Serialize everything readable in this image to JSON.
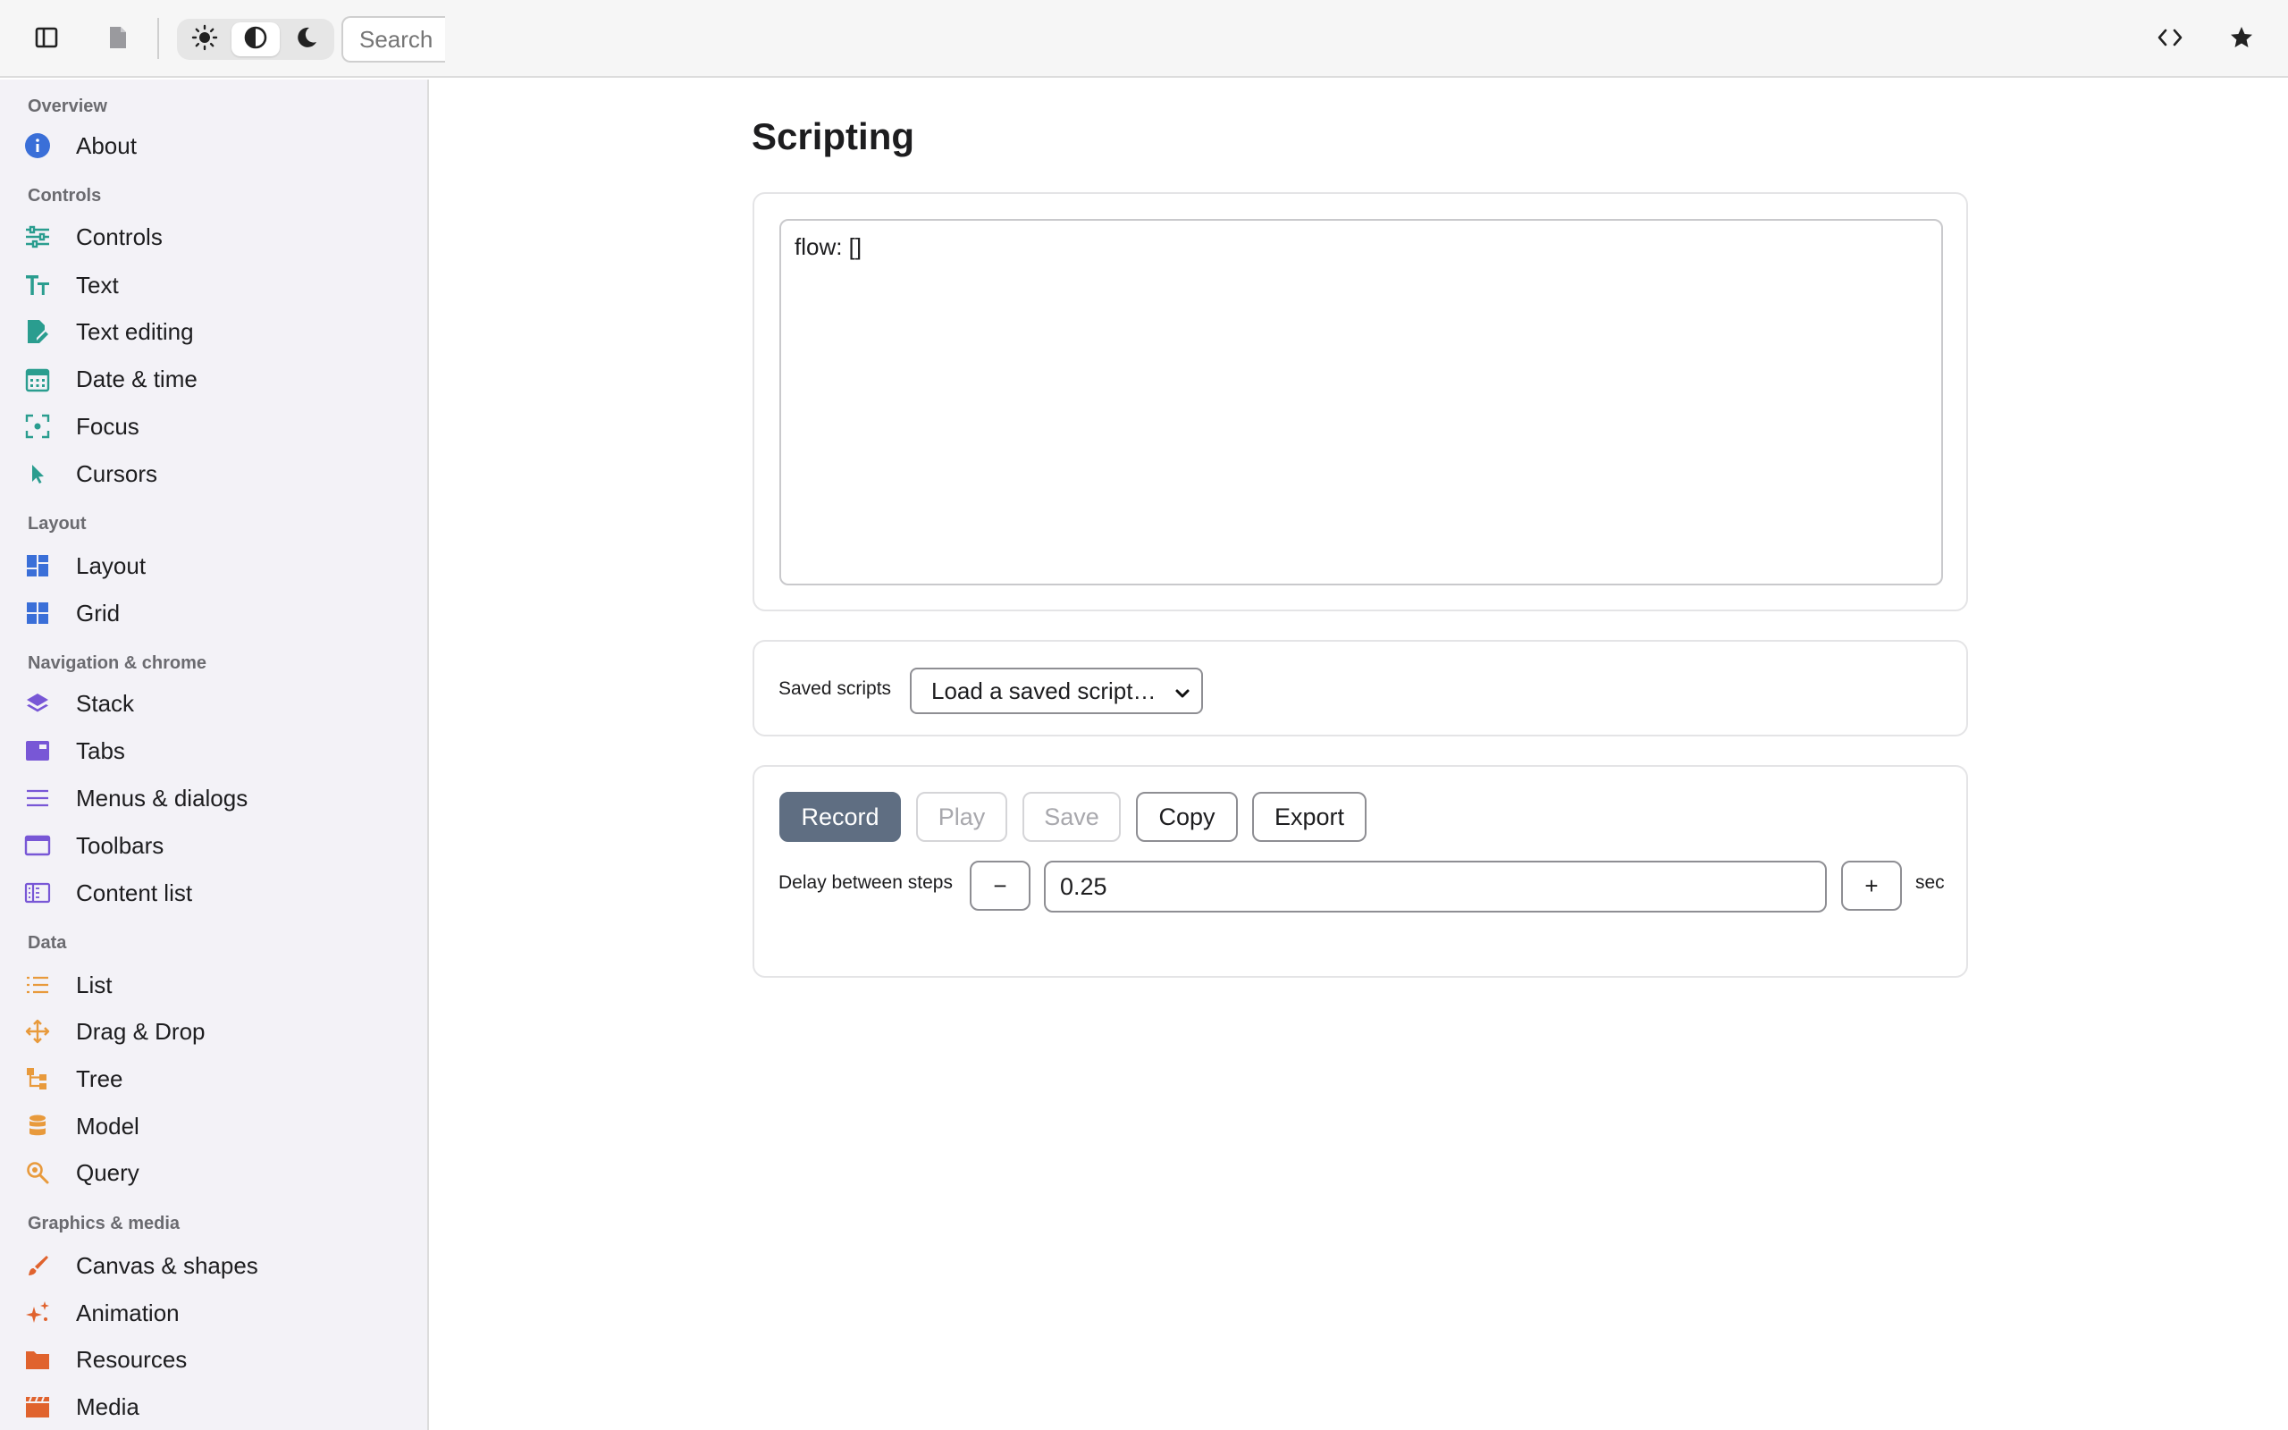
{
  "toolbar": {
    "search_placeholder": "Search",
    "icons": [
      "sidebar-toggle-icon",
      "file-icon",
      "sun-icon",
      "contrast-icon",
      "moon-icon",
      "code-icon",
      "star-icon"
    ]
  },
  "sidebar": {
    "sections": [
      {
        "title": "Overview",
        "items": [
          {
            "label": "About",
            "icon": "info-icon"
          }
        ]
      },
      {
        "title": "Controls",
        "items": [
          {
            "label": "Controls",
            "icon": "sliders-icon"
          },
          {
            "label": "Text",
            "icon": "text-size-icon"
          },
          {
            "label": "Text editing",
            "icon": "edit-document-icon"
          },
          {
            "label": "Date & time",
            "icon": "calendar-icon"
          },
          {
            "label": "Focus",
            "icon": "focus-icon"
          },
          {
            "label": "Cursors",
            "icon": "cursor-icon"
          }
        ]
      },
      {
        "title": "Layout",
        "items": [
          {
            "label": "Layout",
            "icon": "layout-icon"
          },
          {
            "label": "Grid",
            "icon": "grid-icon"
          }
        ]
      },
      {
        "title": "Navigation & chrome",
        "items": [
          {
            "label": "Stack",
            "icon": "stack-icon"
          },
          {
            "label": "Tabs",
            "icon": "tabs-icon"
          },
          {
            "label": "Menus & dialogs",
            "icon": "menu-icon"
          },
          {
            "label": "Toolbars",
            "icon": "toolbar-icon"
          },
          {
            "label": "Content list",
            "icon": "content-list-icon"
          }
        ]
      },
      {
        "title": "Data",
        "items": [
          {
            "label": "List",
            "icon": "list-icon"
          },
          {
            "label": "Drag & Drop",
            "icon": "move-icon"
          },
          {
            "label": "Tree",
            "icon": "tree-icon"
          },
          {
            "label": "Model",
            "icon": "database-icon"
          },
          {
            "label": "Query",
            "icon": "query-icon"
          }
        ]
      },
      {
        "title": "Graphics & media",
        "items": [
          {
            "label": "Canvas & shapes",
            "icon": "brush-icon"
          },
          {
            "label": "Animation",
            "icon": "sparkles-icon"
          },
          {
            "label": "Resources",
            "icon": "folder-icon"
          },
          {
            "label": "Media",
            "icon": "clapperboard-icon"
          }
        ]
      }
    ]
  },
  "main": {
    "title": "Scripting",
    "editor_value": "flow: []",
    "saved_scripts_label": "Saved scripts",
    "saved_scripts_selected": "Load a saved script…",
    "buttons": {
      "record": "Record",
      "play": "Play",
      "save": "Save",
      "copy": "Copy",
      "export": "Export"
    },
    "delay_label": "Delay between steps",
    "minus": "−",
    "plus": "+",
    "delay_value": "0.25",
    "unit": "sec"
  },
  "colors": {
    "teal": "#2a9d8f",
    "blue": "#3a6fd8",
    "purple": "#7857d6",
    "orange": "#e89a3c",
    "red_orange": "#e0632e",
    "primary_button": "#5f6e82"
  }
}
